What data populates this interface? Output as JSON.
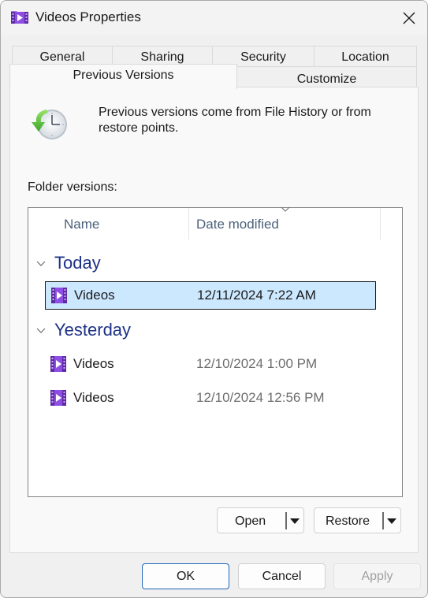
{
  "window": {
    "title": "Videos Properties",
    "title_icon": "video-folder-icon",
    "close_icon": "close-icon"
  },
  "tabs": {
    "row1": [
      {
        "label": "General"
      },
      {
        "label": "Sharing"
      },
      {
        "label": "Security"
      },
      {
        "label": "Location"
      }
    ],
    "row2": [
      {
        "label": "Previous Versions",
        "active": true
      },
      {
        "label": "Customize"
      }
    ]
  },
  "panel": {
    "info_icon": "restore-clock-icon",
    "info_text": "Previous versions come from File History or from restore points.",
    "folder_versions_label": "Folder versions:",
    "list": {
      "columns": [
        {
          "label": "Name"
        },
        {
          "label": "Date modified",
          "sorted": "descending"
        }
      ],
      "groups": [
        {
          "title": "Today",
          "items": [
            {
              "name": "Videos",
              "date": "12/11/2024 7:22 AM",
              "selected": true,
              "icon": "video-folder-icon"
            }
          ]
        },
        {
          "title": "Yesterday",
          "items": [
            {
              "name": "Videos",
              "date": "12/10/2024 1:00 PM",
              "selected": false,
              "icon": "video-folder-icon"
            },
            {
              "name": "Videos",
              "date": "12/10/2024 12:56 PM",
              "selected": false,
              "icon": "video-folder-icon"
            }
          ]
        }
      ]
    },
    "buttons": {
      "open": "Open",
      "restore": "Restore"
    }
  },
  "footer": {
    "ok": "OK",
    "cancel": "Cancel",
    "apply": "Apply"
  },
  "colors": {
    "selection": "#cce8ff",
    "group_title": "#1e3287",
    "accent_border": "#1d67b8",
    "folder_purple": "#8b4fe0"
  }
}
